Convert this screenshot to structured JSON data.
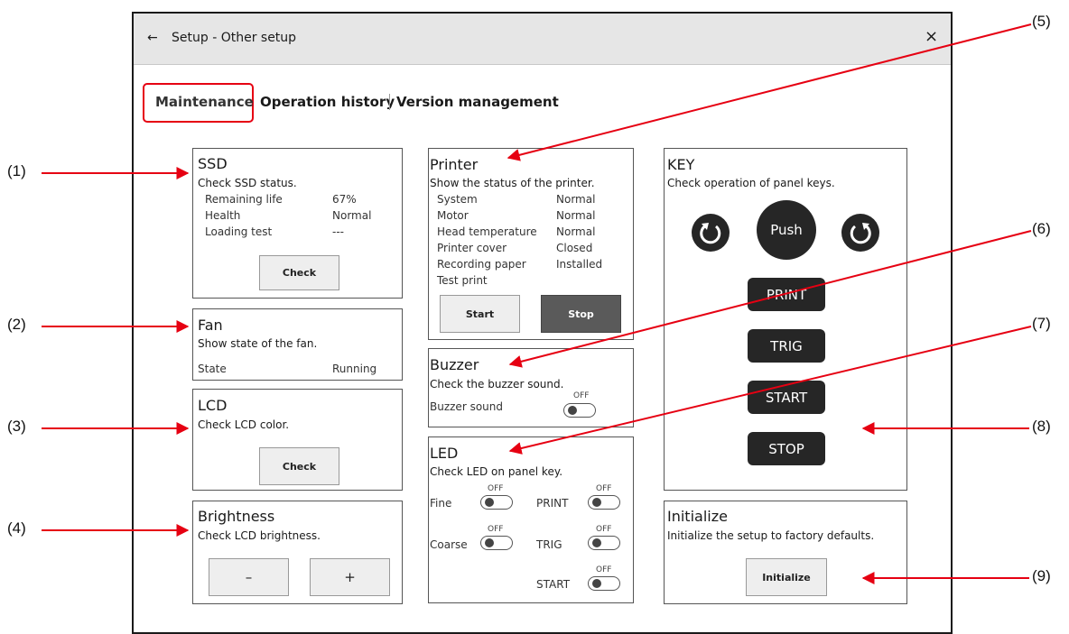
{
  "window": {
    "title": "Setup - Other setup",
    "back_icon": "←",
    "close_icon": "×"
  },
  "tabs": [
    {
      "label": "Maintenance",
      "active": true
    },
    {
      "label": "Operation history",
      "active": false
    },
    {
      "label": "Version management",
      "active": false
    }
  ],
  "ssd": {
    "title": "SSD",
    "desc": "Check SSD status.",
    "rows": [
      {
        "label": "Remaining life",
        "value": "67%"
      },
      {
        "label": "Health",
        "value": "Normal"
      },
      {
        "label": "Loading test",
        "value": "---"
      }
    ],
    "button": "Check"
  },
  "fan": {
    "title": "Fan",
    "desc": "Show state of the fan.",
    "state_label": "State",
    "state_value": "Running"
  },
  "lcd": {
    "title": "LCD",
    "desc": "Check LCD color.",
    "button": "Check"
  },
  "brightness": {
    "title": "Brightness",
    "desc": "Check LCD brightness.",
    "minus": "–",
    "plus": "+"
  },
  "printer": {
    "title": "Printer",
    "desc": "Show the status of the printer.",
    "rows": [
      {
        "label": "System",
        "value": "Normal"
      },
      {
        "label": "Motor",
        "value": "Normal"
      },
      {
        "label": "Head temperature",
        "value": "Normal"
      },
      {
        "label": "Printer cover",
        "value": "Closed"
      },
      {
        "label": "Recording paper",
        "value": "Installed"
      },
      {
        "label": "Test print",
        "value": ""
      }
    ],
    "start": "Start",
    "stop": "Stop"
  },
  "buzzer": {
    "title": "Buzzer",
    "desc": "Check the buzzer sound.",
    "label": "Buzzer sound",
    "toggle": "OFF"
  },
  "led": {
    "title": "LED",
    "desc": "Check LED on panel key.",
    "fine": "Fine",
    "coarse": "Coarse",
    "print": "PRINT",
    "trig": "TRIG",
    "start": "START",
    "off": "OFF"
  },
  "key": {
    "title": "KEY",
    "desc": "Check operation of panel keys.",
    "push": "Push",
    "print": "PRINT",
    "trig": "TRIG",
    "start": "START",
    "stop": "STOP"
  },
  "initialize": {
    "title": "Initialize",
    "desc": "Initialize the setup to factory defaults.",
    "button": "Initialize"
  },
  "callouts": [
    "(1)",
    "(2)",
    "(3)",
    "(4)",
    "(5)",
    "(6)",
    "(7)",
    "(8)",
    "(9)"
  ],
  "colors": {
    "accent_red": "#e60012",
    "key_dark": "#262626",
    "titlebar": "#e6e6e6"
  }
}
